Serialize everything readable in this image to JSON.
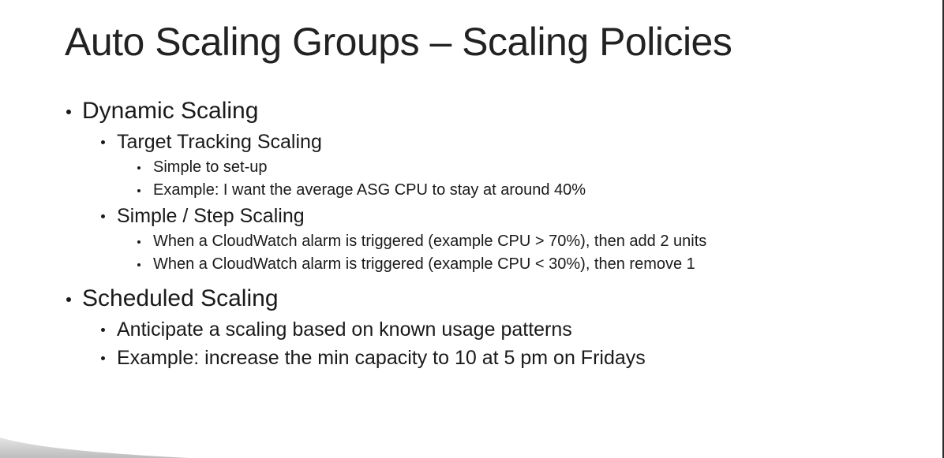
{
  "slide": {
    "title": "Auto Scaling Groups – Scaling Policies",
    "sections": [
      {
        "label": "Dynamic Scaling",
        "items": [
          {
            "label": "Target Tracking Scaling",
            "subitems": [
              "Simple to set-up",
              "Example: I want the average ASG CPU to stay at around 40%"
            ]
          },
          {
            "label": "Simple / Step Scaling",
            "subitems": [
              "When a CloudWatch alarm is triggered (example CPU > 70%), then add 2 units",
              "When a CloudWatch alarm is triggered (example CPU < 30%), then remove 1"
            ]
          }
        ]
      },
      {
        "label": "Scheduled Scaling",
        "items": [
          {
            "label": "Anticipate a scaling based on known usage patterns"
          },
          {
            "label": "Example: increase the min capacity to 10 at 5 pm on Fridays"
          }
        ]
      }
    ]
  },
  "colors": {
    "background": "#ffffff",
    "text": "#1a1a1a",
    "edge": "#2b2b2b",
    "curl_shadow": "#c8c8c8"
  }
}
